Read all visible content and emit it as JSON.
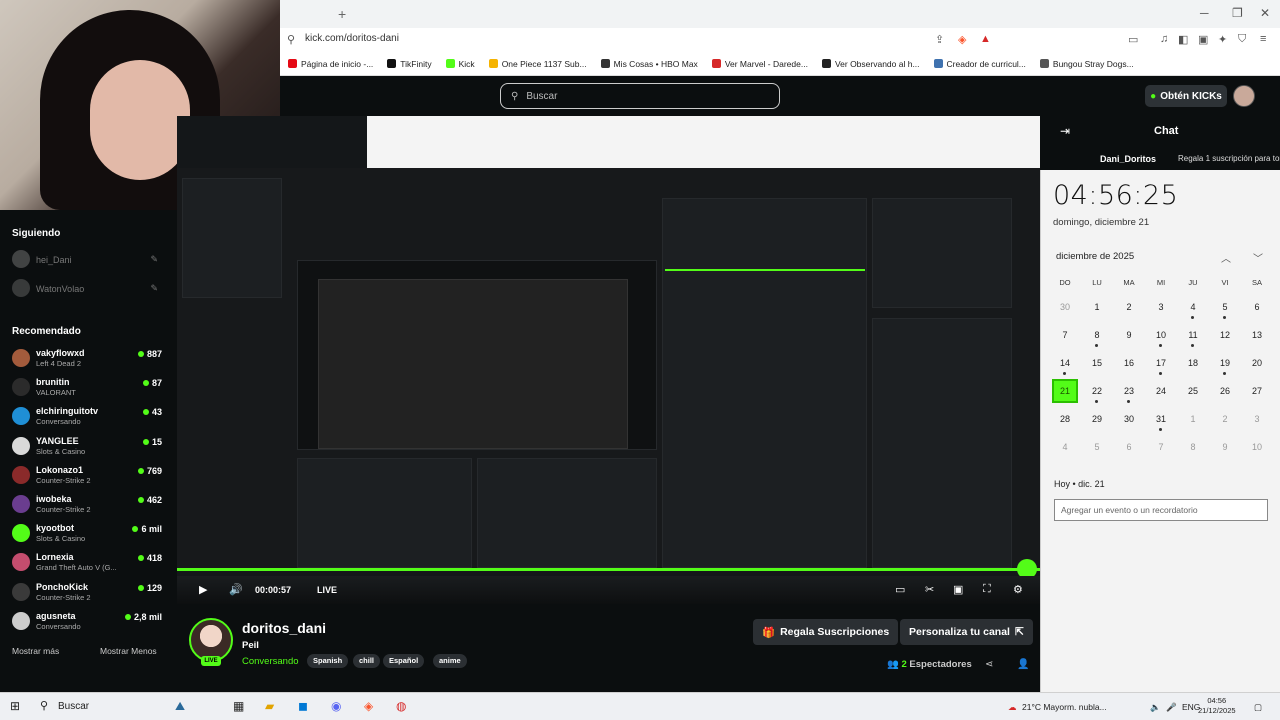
{
  "browser": {
    "url": "kick.com/doritos-dani",
    "bookmarks": [
      "Página de inicio -...",
      "TikFinity",
      "Kick",
      "One Piece 1137 Sub...",
      "Mis Cosas • HBO Max",
      "Ver Marvel - Darede...",
      "Ver Observando al h...",
      "Creador de curricul...",
      "Bungou Stray Dogs..."
    ],
    "bookmark_colors": [
      "#e50914",
      "#111111",
      "#53fc18",
      "#f5b301",
      "#333333",
      "#d62828",
      "#222222",
      "#3f72af",
      "#555555"
    ]
  },
  "header": {
    "search_placeholder": "Buscar",
    "get_kicks": "Obtén KICKs"
  },
  "sidebar": {
    "following_title": "Siguiendo",
    "following": [
      {
        "name": "hei_Dani",
        "color": "#777777"
      },
      {
        "name": "WatonVolao",
        "color": "#666666"
      }
    ],
    "recommended_title": "Recomendado",
    "recommended": [
      {
        "name": "vakyflowxd",
        "game": "Left 4 Dead 2",
        "viewers": "887",
        "color": "#a35b3c"
      },
      {
        "name": "brunitin",
        "game": "VALORANT",
        "viewers": "87",
        "color": "#2b2b2b"
      },
      {
        "name": "elchiringuitotv",
        "game": "Conversando",
        "viewers": "43",
        "color": "#1f8fd6"
      },
      {
        "name": "YANGLEE",
        "game": "Slots & Casino",
        "viewers": "15",
        "color": "#d9d9d9"
      },
      {
        "name": "Lokonazo1",
        "game": "Counter-Strike 2",
        "viewers": "769",
        "color": "#8a2a2a"
      },
      {
        "name": "iwobeka",
        "game": "Counter-Strike 2",
        "viewers": "462",
        "color": "#6a3d8f"
      },
      {
        "name": "kyootbot",
        "game": "Slots & Casino",
        "viewers": "6 mil",
        "color": "#53fc18"
      },
      {
        "name": "Lornexia",
        "game": "Grand Theft Auto V (G...",
        "viewers": "418",
        "color": "#c44d6e"
      },
      {
        "name": "PonchoKick",
        "game": "Counter-Strike 2",
        "viewers": "129",
        "color": "#3a3a3a"
      },
      {
        "name": "agusneta",
        "game": "Conversando",
        "viewers": "2,8 mil",
        "color": "#cccccc"
      }
    ],
    "show_more": "Mostrar más",
    "show_less": "Mostrar Menos"
  },
  "player": {
    "timecode": "00:00:57",
    "live_label": "LIVE"
  },
  "chat": {
    "title": "Chat",
    "gifter": "Dani_Doritos",
    "gift_text": "Regala 1 suscripción para tomar la"
  },
  "calendar": {
    "time": "04:56:25",
    "date": "domingo, diciembre 21",
    "month": "diciembre de 2025",
    "weekdays": [
      "DO",
      "LU",
      "MA",
      "MI",
      "JU",
      "VI",
      "SA"
    ],
    "days": [
      [
        "30",
        "1",
        "2",
        "3",
        "4",
        "5",
        "6"
      ],
      [
        "7",
        "8",
        "9",
        "10",
        "11",
        "12",
        "13"
      ],
      [
        "14",
        "15",
        "16",
        "17",
        "18",
        "19",
        "20"
      ],
      [
        "21",
        "22",
        "23",
        "24",
        "25",
        "26",
        "27"
      ],
      [
        "28",
        "29",
        "30",
        "31",
        "1",
        "2",
        "3"
      ],
      [
        "4",
        "5",
        "6",
        "7",
        "8",
        "9",
        "10"
      ]
    ],
    "today_label": "Hoy • dic. 21",
    "event_placeholder": "Agregar un evento o un recordatorio"
  },
  "channel": {
    "name": "doritos_dani",
    "title": "Peil",
    "category": "Conversando",
    "tags": [
      "Spanish",
      "chill",
      "Español",
      "anime"
    ],
    "gift_subs": "Regala Suscripciones",
    "customize": "Personaliza tu canal",
    "viewers_count": "2",
    "viewers_label": "Espectadores",
    "live_badge": "LIVE"
  },
  "taskbar": {
    "search": "Buscar",
    "weather": "21°C  Mayorm. nubla...",
    "lang": "ENG",
    "time": "04:56",
    "date": "21/12/2025"
  }
}
